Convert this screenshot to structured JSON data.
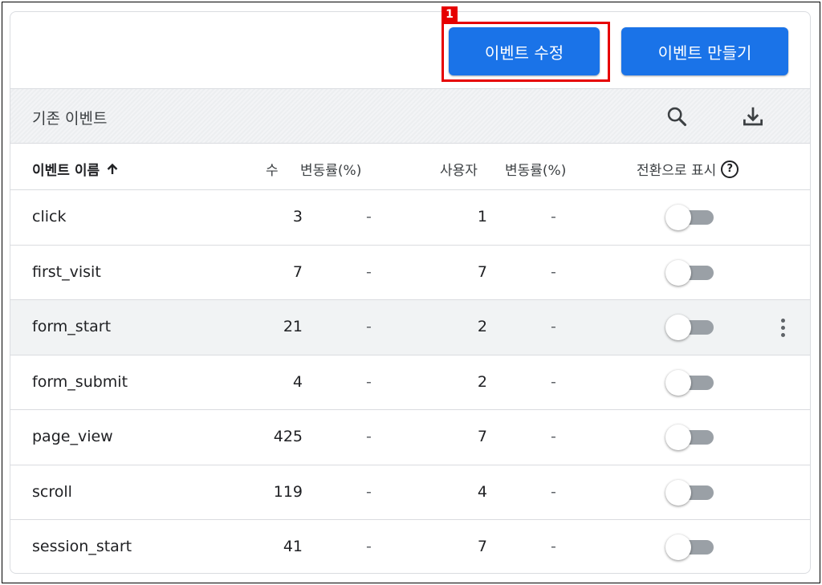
{
  "actions": {
    "edit_label": "이벤트 수정",
    "create_label": "이벤트 만들기",
    "annotation_tag": "1"
  },
  "header": {
    "title": "기존 이벤트",
    "search_icon": "search-icon",
    "download_icon": "download-icon"
  },
  "columns": {
    "name": "이벤트 이름",
    "count": "수",
    "count_change": "변동률(%)",
    "users": "사용자",
    "users_change": "변동률(%)",
    "conversion": "전환으로 표시",
    "help": "?"
  },
  "rows": [
    {
      "name": "click",
      "count": "3",
      "count_change": "-",
      "users": "1",
      "users_change": "-",
      "conversion": false
    },
    {
      "name": "first_visit",
      "count": "7",
      "count_change": "-",
      "users": "7",
      "users_change": "-",
      "conversion": false
    },
    {
      "name": "form_start",
      "count": "21",
      "count_change": "-",
      "users": "2",
      "users_change": "-",
      "conversion": false
    },
    {
      "name": "form_submit",
      "count": "4",
      "count_change": "-",
      "users": "2",
      "users_change": "-",
      "conversion": false
    },
    {
      "name": "page_view",
      "count": "425",
      "count_change": "-",
      "users": "7",
      "users_change": "-",
      "conversion": false
    },
    {
      "name": "scroll",
      "count": "119",
      "count_change": "-",
      "users": "4",
      "users_change": "-",
      "conversion": false
    },
    {
      "name": "session_start",
      "count": "41",
      "count_change": "-",
      "users": "7",
      "users_change": "-",
      "conversion": false
    }
  ],
  "colors": {
    "primary": "#1a73e8",
    "annotation": "#e60000"
  }
}
